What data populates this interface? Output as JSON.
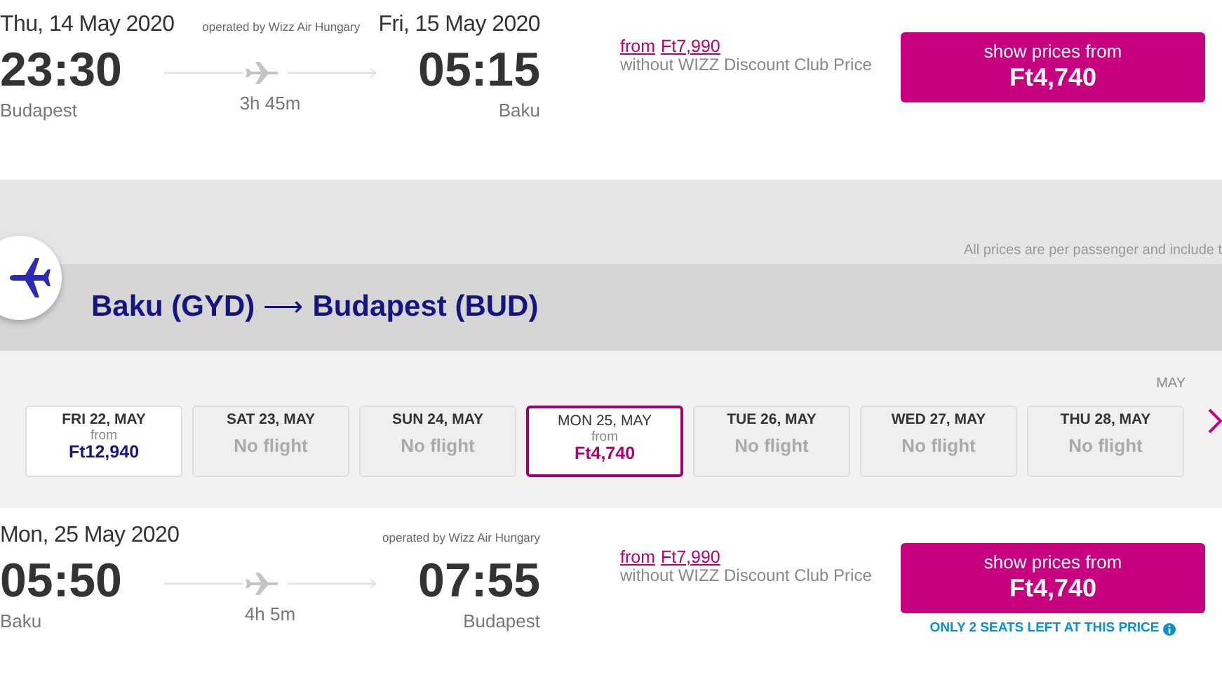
{
  "flights": [
    {
      "departure_date": "Thu, 14 May 2020",
      "operator": "operated by Wizz Air Hungary",
      "arrival_date": "Fri, 15 May 2020",
      "departure_time": "23:30",
      "arrival_time": "05:15",
      "duration": "3h 45m",
      "origin": "Budapest",
      "destination": "Baku",
      "from_label": "from",
      "regular_price": "Ft7,990",
      "price_note": "without WIZZ Discount Club Price",
      "button_label": "show prices from",
      "button_price": "Ft4,740"
    },
    {
      "departure_date": "Mon, 25 May 2020",
      "operator": "operated by Wizz Air Hungary",
      "departure_time": "05:50",
      "arrival_time": "07:55",
      "duration": "4h 5m",
      "origin": "Baku",
      "destination": "Budapest",
      "from_label": "from",
      "regular_price": "Ft7,990",
      "price_note": "without WIZZ Discount Club Price",
      "button_label": "show prices from",
      "button_price": "Ft4,740",
      "seats_warning": "ONLY 2 SEATS LEFT AT THIS PRICE"
    }
  ],
  "notice": "All prices are per passenger and include t",
  "route": {
    "origin": "Baku (GYD)",
    "arrow": "⟶",
    "destination": "Budapest (BUD)"
  },
  "month_label": "MAY",
  "days": [
    {
      "label": "FRI 22, MAY",
      "kind": "flight",
      "from": "from",
      "price": "Ft12,940",
      "selected": false
    },
    {
      "label": "SAT 23, MAY",
      "kind": "no-flight",
      "status": "No flight",
      "selected": false
    },
    {
      "label": "SUN 24, MAY",
      "kind": "no-flight",
      "status": "No flight",
      "selected": false
    },
    {
      "label": "MON 25, MAY",
      "kind": "flight",
      "from": "from",
      "price": "Ft4,740",
      "selected": true
    },
    {
      "label": "TUE 26, MAY",
      "kind": "no-flight",
      "status": "No flight",
      "selected": false
    },
    {
      "label": "WED 27, MAY",
      "kind": "no-flight",
      "status": "No flight",
      "selected": false
    },
    {
      "label": "THU 28, MAY",
      "kind": "no-flight",
      "status": "No flight",
      "selected": false
    }
  ]
}
